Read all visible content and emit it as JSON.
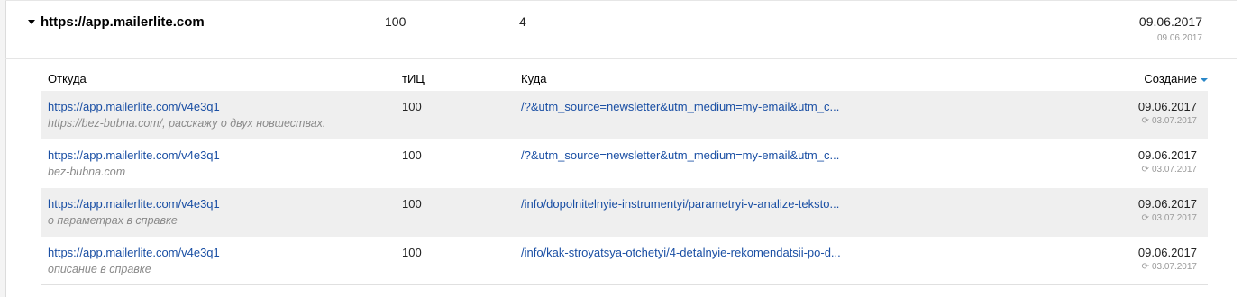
{
  "group": {
    "domain": "https://app.mailerlite.com",
    "tic": "100",
    "count": "4",
    "date": "09.06.2017",
    "subdate": "09.06.2017"
  },
  "columns": {
    "from": "Откуда",
    "tic": "тИЦ",
    "to": "Куда",
    "created": "Создание"
  },
  "rows": [
    {
      "from_url": "https://app.mailerlite.com/v4e3q1",
      "from_desc": "https://bez-bubna.com/, расскажу о двух новшествах.",
      "tic": "100",
      "to_url": "/?&utm_source=newsletter&utm_medium=my-email&utm_c...",
      "date": "09.06.2017",
      "updated": "03.07.2017"
    },
    {
      "from_url": "https://app.mailerlite.com/v4e3q1",
      "from_desc": "bez-bubna.com",
      "tic": "100",
      "to_url": "/?&utm_source=newsletter&utm_medium=my-email&utm_c...",
      "date": "09.06.2017",
      "updated": "03.07.2017"
    },
    {
      "from_url": "https://app.mailerlite.com/v4e3q1",
      "from_desc": "о параметрах в справке",
      "tic": "100",
      "to_url": "/info/dopolnitelnyie-instrumentyi/parametryi-v-analize-teksto...",
      "date": "09.06.2017",
      "updated": "03.07.2017"
    },
    {
      "from_url": "https://app.mailerlite.com/v4e3q1",
      "from_desc": "описание в справке",
      "tic": "100",
      "to_url": "/info/kak-stroyatsya-otchetyi/4-detalnyie-rekomendatsii-po-d...",
      "date": "09.06.2017",
      "updated": "03.07.2017"
    }
  ],
  "icons": {
    "toggle": "caret-down-icon",
    "sort": "sort-desc-icon",
    "refresh": "refresh-icon"
  },
  "colors": {
    "link": "#1a4fa4",
    "sort_arrow": "#2a87c8",
    "alt_row": "#efefef"
  }
}
